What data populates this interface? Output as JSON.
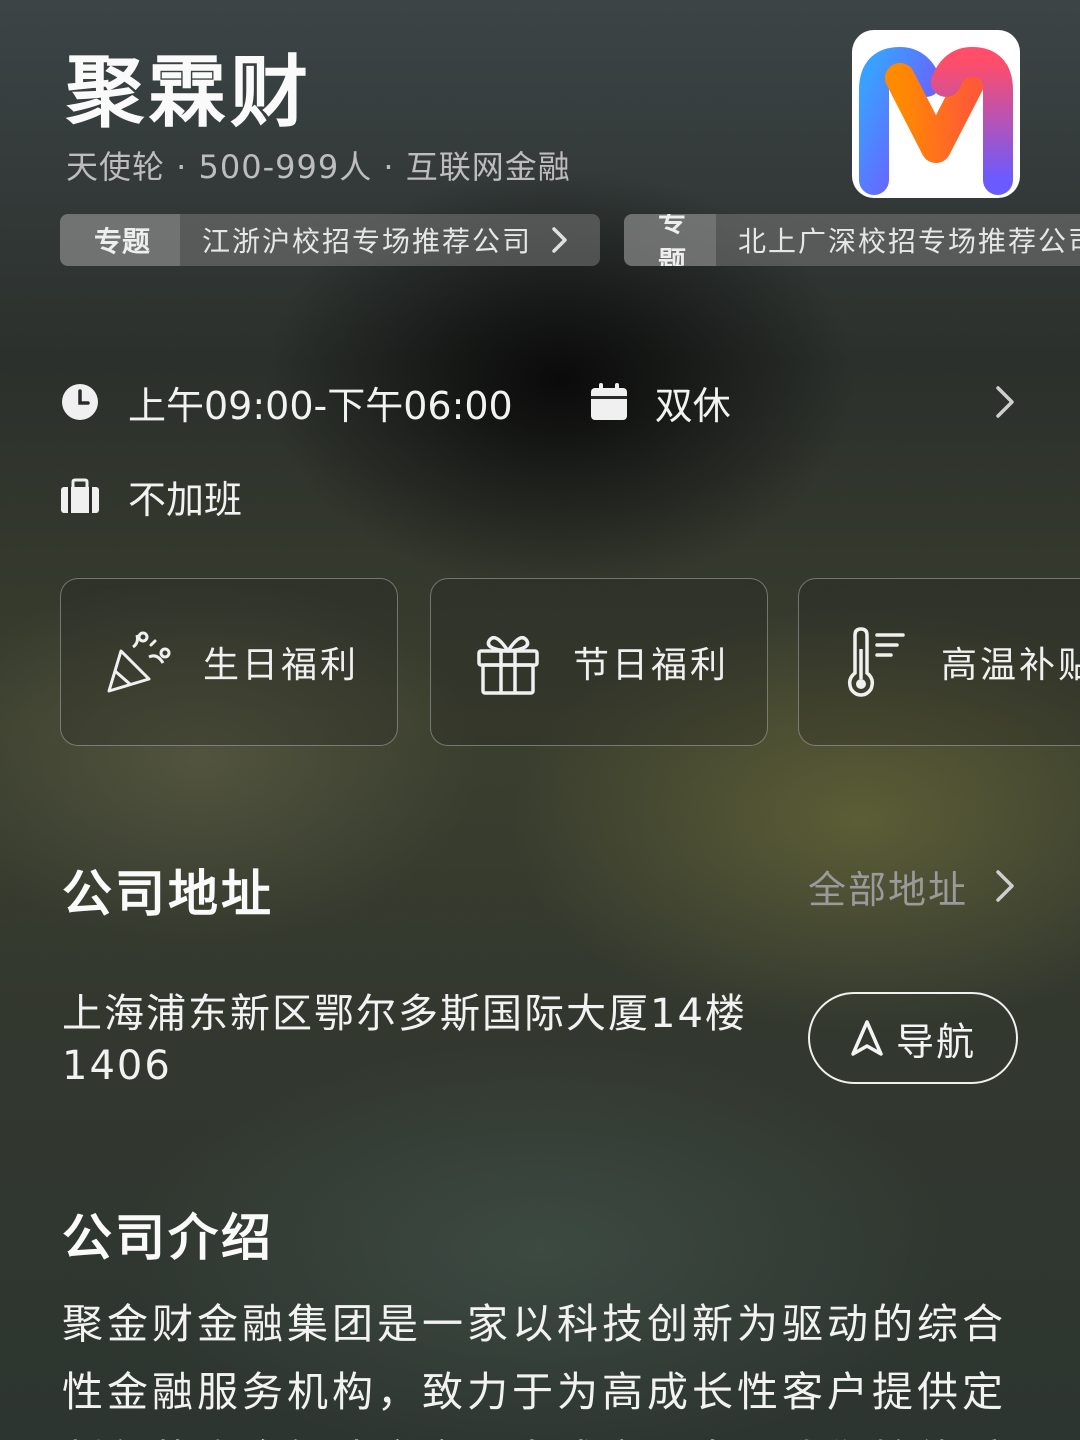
{
  "company": {
    "name": "聚霖财",
    "meta": "天使轮 · 500-999人 · 互联网金融"
  },
  "topics": [
    {
      "tag": "专题",
      "text": "江浙沪校招专场推荐公司"
    },
    {
      "tag": "专题",
      "text": "北上广深校招专场推荐公司"
    }
  ],
  "work_info": {
    "hours": "上午09:00-下午06:00",
    "rest": "双休",
    "overtime": "不加班"
  },
  "benefits": [
    {
      "label": "生日福利",
      "icon": "party-popper-icon"
    },
    {
      "label": "节日福利",
      "icon": "gift-icon"
    },
    {
      "label": "高温补贴",
      "icon": "thermometer-icon"
    }
  ],
  "address_section": {
    "title": "公司地址",
    "all_link": "全部地址",
    "address": "上海浦东新区鄂尔多斯国际大厦14楼1406",
    "nav_label": "导航"
  },
  "intro_section": {
    "title": "公司介绍",
    "text": "聚金财金融集团是一家以科技创新为驱动的综合性金融服务机构，致力于为高成长性客户提供定制化的资金解决方案，自成立以来，我们始终秉"
  },
  "colors": {
    "logo_blue": "#4a7bff",
    "logo_orange": "#ff7a1a",
    "logo_pink": "#e8456c",
    "muted_text": "#9a9a9a"
  }
}
